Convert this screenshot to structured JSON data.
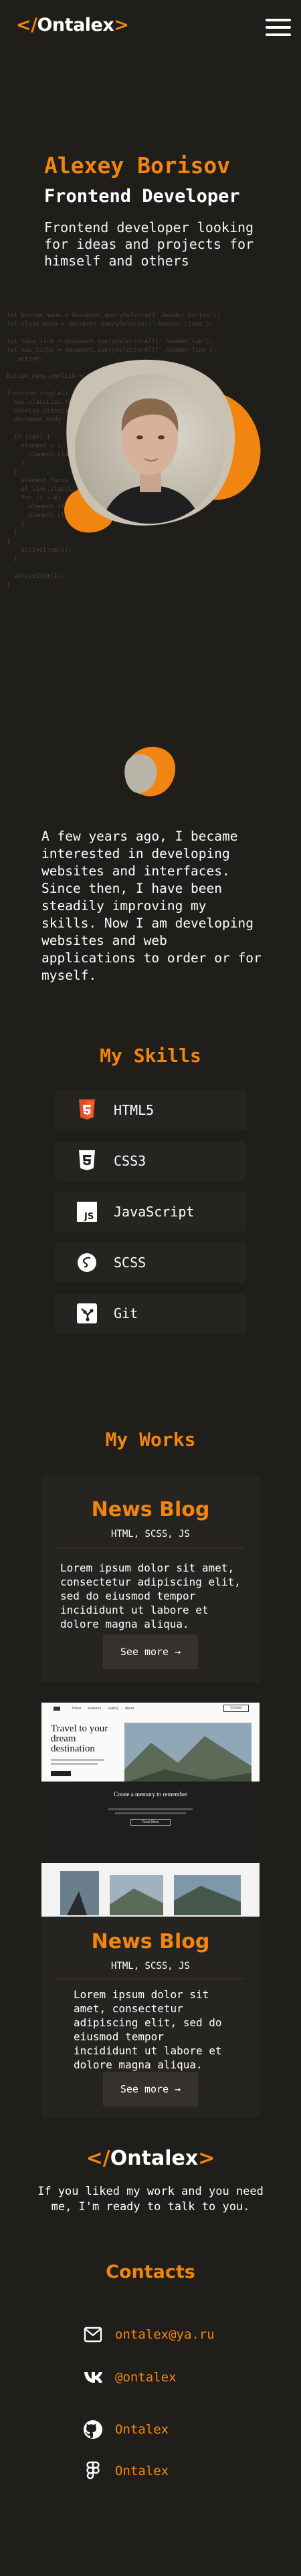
{
  "header": {
    "logo_open": "</",
    "logo_name": "Ontalex",
    "logo_close": ">",
    "menu_icon": "hamburger-icon"
  },
  "hero": {
    "name": "Alexey Borisov",
    "role": "Frontend Developer",
    "description": "Frontend developer looking for ideas and projects for himself and others"
  },
  "about": {
    "text": "A few years ago, I became interested in developing websites and interfaces. Since then, I have been steadily improving my skills. Now I am developing websites and web applications to order or for myself."
  },
  "skills": {
    "title": "My Skills",
    "items": [
      {
        "label": "HTML5",
        "icon": "html5-icon"
      },
      {
        "label": "CSS3",
        "icon": "css3-icon"
      },
      {
        "label": "JavaScript",
        "icon": "javascript-icon"
      },
      {
        "label": "SCSS",
        "icon": "sass-icon"
      },
      {
        "label": "Git",
        "icon": "git-icon"
      }
    ]
  },
  "works": {
    "title": "My Works",
    "cards": [
      {
        "title": "News Blog",
        "tags": "HTML, SCSS, JS",
        "description": "Lorem ipsum dolor sit amet, consectetur adipiscing elit, sed do eiusmod tempor incididunt ut labore et dolore magna aliqua.",
        "button": "See more →"
      },
      {
        "title": "News Blog",
        "tags": "HTML, SCSS, JS",
        "description": "Lorem ipsum dolor sit amet, consectetur adipiscing elit, sed do eiusmod tempor incididunt ut labore et dolore magna aliqua.",
        "button": "See more →"
      }
    ],
    "preview": {
      "nav_items": [
        "Home",
        "Features",
        "Gallery",
        "About"
      ],
      "nav_button": "Contact",
      "headline": "Travel to your dream destination",
      "section_title": "Create a memory to remember",
      "section_button": "Read More"
    }
  },
  "contact": {
    "logo_open": "</",
    "logo_name": "Ontalex",
    "logo_close": ">",
    "cta": "If you liked my work and you need me, I'm ready to talk to you.",
    "title": "Contacts",
    "items": [
      {
        "label": "ontalex@ya.ru",
        "icon": "mail-icon"
      },
      {
        "label": "@ontalex",
        "icon": "vk-icon"
      },
      {
        "label": "Ontalex",
        "icon": "github-icon"
      },
      {
        "label": "Ontalex",
        "icon": "figma-icon"
      }
    ]
  },
  "colors": {
    "background": "#201e1b",
    "accent": "#f2850f",
    "card": "#262420"
  }
}
